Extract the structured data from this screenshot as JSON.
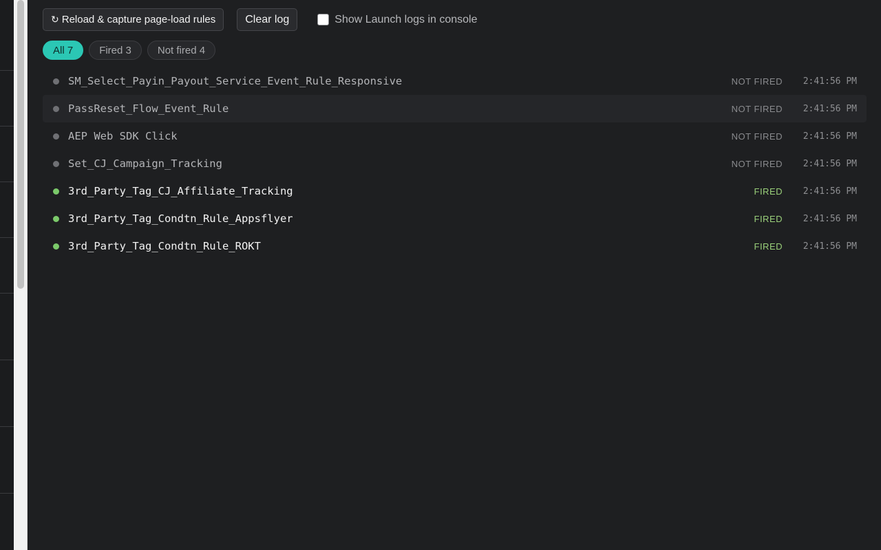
{
  "toolbar": {
    "reload_icon": "reload-icon",
    "reload_label": "Reload & capture page-load rules",
    "clear_label": "Clear log",
    "console_checkbox_label": "Show Launch logs in console",
    "console_checkbox_checked": false
  },
  "filters": [
    {
      "label": "All 7",
      "active": true
    },
    {
      "label": "Fired 3",
      "active": false
    },
    {
      "label": "Not fired 4",
      "active": false
    }
  ],
  "rules": [
    {
      "name": "SM_Select_Payin_Payout_Service_Event_Rule_Responsive",
      "status": "NOT FIRED",
      "time": "2:41:56 PM"
    },
    {
      "name": "PassReset_Flow_Event_Rule",
      "status": "NOT FIRED",
      "time": "2:41:56 PM"
    },
    {
      "name": "AEP Web SDK Click",
      "status": "NOT FIRED",
      "time": "2:41:56 PM"
    },
    {
      "name": "Set_CJ_Campaign_Tracking",
      "status": "NOT FIRED",
      "time": "2:41:56 PM"
    },
    {
      "name": "3rd_Party_Tag_CJ_Affiliate_Tracking",
      "status": "FIRED",
      "time": "2:41:56 PM"
    },
    {
      "name": "3rd_Party_Tag_Condtn_Rule_Appsflyer",
      "status": "FIRED",
      "time": "2:41:56 PM"
    },
    {
      "name": "3rd_Party_Tag_Condtn_Rule_ROKT",
      "status": "FIRED",
      "time": "2:41:56 PM"
    }
  ],
  "colors": {
    "accent": "#2bc7b4",
    "fired": "#7bc96a",
    "not_fired": "#6f7074",
    "background": "#1e1f21"
  }
}
